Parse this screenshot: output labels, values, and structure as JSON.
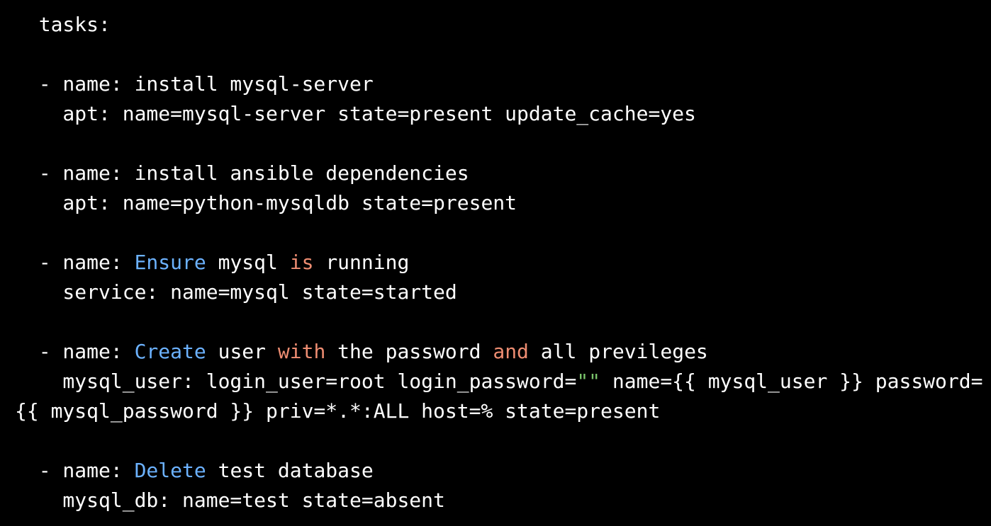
{
  "colors": {
    "background": "#000000",
    "text": "#ffffff",
    "keyword_blue": "#6cb2ff",
    "keyword_orange": "#ee8d72",
    "string_green": "#7ac46b"
  },
  "lines": [
    {
      "segments": [
        {
          "text": "  tasks:",
          "style": "plain"
        }
      ]
    },
    {
      "segments": []
    },
    {
      "segments": [
        {
          "text": "  - name: install mysql-server",
          "style": "plain"
        }
      ]
    },
    {
      "segments": [
        {
          "text": "    apt: name=mysql-server state=present update_cache=yes",
          "style": "plain"
        }
      ]
    },
    {
      "segments": []
    },
    {
      "segments": [
        {
          "text": "  - name: install ansible dependencies",
          "style": "plain"
        }
      ]
    },
    {
      "segments": [
        {
          "text": "    apt: name=python-mysqldb state=present",
          "style": "plain"
        }
      ]
    },
    {
      "segments": []
    },
    {
      "segments": [
        {
          "text": "  - name: ",
          "style": "plain"
        },
        {
          "text": "Ensure",
          "style": "blue"
        },
        {
          "text": " mysql ",
          "style": "plain"
        },
        {
          "text": "is",
          "style": "orange"
        },
        {
          "text": " running",
          "style": "plain"
        }
      ]
    },
    {
      "segments": [
        {
          "text": "    service: name=mysql state=started",
          "style": "plain"
        }
      ]
    },
    {
      "segments": []
    },
    {
      "segments": [
        {
          "text": "  - name: ",
          "style": "plain"
        },
        {
          "text": "Create",
          "style": "blue"
        },
        {
          "text": " user ",
          "style": "plain"
        },
        {
          "text": "with",
          "style": "orange"
        },
        {
          "text": " the password ",
          "style": "plain"
        },
        {
          "text": "and",
          "style": "orange"
        },
        {
          "text": " all previleges",
          "style": "plain"
        }
      ]
    },
    {
      "segments": [
        {
          "text": "    mysql_user: login_user=root login_password=",
          "style": "plain"
        },
        {
          "text": "\"\"",
          "style": "green"
        },
        {
          "text": " name={{ mysql_user }} password=",
          "style": "plain"
        }
      ]
    },
    {
      "segments": [
        {
          "text": "{{ mysql_password }} priv=*.*:ALL host=% state=present",
          "style": "plain"
        }
      ]
    },
    {
      "segments": []
    },
    {
      "segments": [
        {
          "text": "  - name: ",
          "style": "plain"
        },
        {
          "text": "Delete",
          "style": "blue"
        },
        {
          "text": " test database",
          "style": "plain"
        }
      ]
    },
    {
      "segments": [
        {
          "text": "    mysql_db: name=test state=absent",
          "style": "plain"
        }
      ]
    }
  ]
}
